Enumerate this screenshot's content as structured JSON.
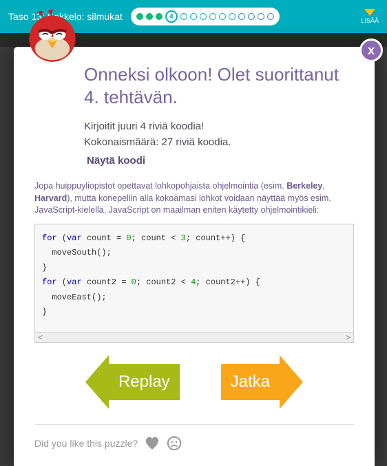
{
  "topbar": {
    "level_label": "Taso 13: Sokkelo: silmukat",
    "current_step": "4",
    "lisaa_label": "LISÄÄ"
  },
  "modal": {
    "close_label": "x",
    "title": "Onneksi olkoon! Olet suorittanut 4. tehtävän.",
    "stat1": "Kirjoitit juuri 4 riviä koodia!",
    "stat2": "Kokonaismäärä: 27 riviä koodia.",
    "show_code": "Näytä koodi",
    "desc_prefix": "Jopa huippuyliopistot opettavat lohkopohjaista ohjelmointia (esim. ",
    "desc_b1": "Berkeley",
    "desc_mid": ", ",
    "desc_b2": "Harvard",
    "desc_suffix": "), mutta konepellin alla kokoamasi lohkot voidaan näyttää myös esim. JavaScript-kielellä. JavaScript on maailman eniten käytetty ohjelmointikieli:",
    "code": "for (var count = 0; count < 3; count++) {\n  moveSouth();\n}\nfor (var count2 = 0; count2 < 4; count2++) {\n  moveEast();\n}",
    "replay_label": "Replay",
    "continue_label": "Jatka",
    "feedback_prompt": "Did you like this puzzle?"
  }
}
